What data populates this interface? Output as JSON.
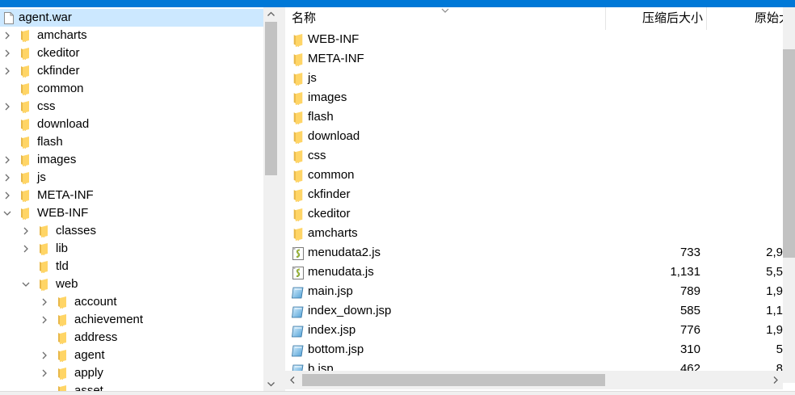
{
  "tree": {
    "items": [
      {
        "label": "agent.war",
        "icon": "archive-file-icon",
        "name": "tree-item-agent-war"
      },
      {
        "label": "amcharts",
        "icon": "folder-icon",
        "name": "tree-item-amcharts"
      },
      {
        "label": "ckeditor",
        "icon": "folder-icon",
        "name": "tree-item-ckeditor"
      },
      {
        "label": "ckfinder",
        "icon": "folder-icon",
        "name": "tree-item-ckfinder"
      },
      {
        "label": "common",
        "icon": "folder-icon",
        "name": "tree-item-common"
      },
      {
        "label": "css",
        "icon": "folder-icon",
        "name": "tree-item-css"
      },
      {
        "label": "download",
        "icon": "folder-icon",
        "name": "tree-item-download"
      },
      {
        "label": "flash",
        "icon": "folder-icon",
        "name": "tree-item-flash"
      },
      {
        "label": "images",
        "icon": "folder-icon",
        "name": "tree-item-images"
      },
      {
        "label": "js",
        "icon": "folder-icon",
        "name": "tree-item-js"
      },
      {
        "label": "META-INF",
        "icon": "folder-icon",
        "name": "tree-item-meta-inf"
      },
      {
        "label": "WEB-INF",
        "icon": "folder-icon",
        "name": "tree-item-web-inf"
      },
      {
        "label": "classes",
        "icon": "folder-icon",
        "name": "tree-item-classes"
      },
      {
        "label": "lib",
        "icon": "folder-icon",
        "name": "tree-item-lib"
      },
      {
        "label": "tld",
        "icon": "folder-icon",
        "name": "tree-item-tld"
      },
      {
        "label": "web",
        "icon": "folder-icon",
        "name": "tree-item-web"
      },
      {
        "label": "account",
        "icon": "folder-icon",
        "name": "tree-item-account"
      },
      {
        "label": "achievement",
        "icon": "folder-icon",
        "name": "tree-item-achievement"
      },
      {
        "label": "address",
        "icon": "folder-icon",
        "name": "tree-item-address"
      },
      {
        "label": "agent",
        "icon": "folder-icon",
        "name": "tree-item-agent"
      },
      {
        "label": "apply",
        "icon": "folder-icon",
        "name": "tree-item-apply"
      },
      {
        "label": "asset",
        "icon": "folder-icon",
        "name": "tree-item-asset"
      }
    ]
  },
  "list": {
    "columns": {
      "name": "名称",
      "compressed": "压缩后大小",
      "original": "原始大小"
    },
    "rows": [
      {
        "name": "WEB-INF",
        "icon": "folder-icon",
        "compressed": "",
        "original": ""
      },
      {
        "name": "META-INF",
        "icon": "folder-icon",
        "compressed": "",
        "original": ""
      },
      {
        "name": "js",
        "icon": "folder-icon",
        "compressed": "",
        "original": ""
      },
      {
        "name": "images",
        "icon": "folder-icon",
        "compressed": "",
        "original": ""
      },
      {
        "name": "flash",
        "icon": "folder-icon",
        "compressed": "",
        "original": ""
      },
      {
        "name": "download",
        "icon": "folder-icon",
        "compressed": "",
        "original": ""
      },
      {
        "name": "css",
        "icon": "folder-icon",
        "compressed": "",
        "original": ""
      },
      {
        "name": "common",
        "icon": "folder-icon",
        "compressed": "",
        "original": ""
      },
      {
        "name": "ckfinder",
        "icon": "folder-icon",
        "compressed": "",
        "original": ""
      },
      {
        "name": "ckeditor",
        "icon": "folder-icon",
        "compressed": "",
        "original": ""
      },
      {
        "name": "amcharts",
        "icon": "folder-icon",
        "compressed": "",
        "original": ""
      },
      {
        "name": "menudata2.js",
        "icon": "js-file-icon",
        "compressed": "733",
        "original": "2,9"
      },
      {
        "name": "menudata.js",
        "icon": "js-file-icon",
        "compressed": "1,131",
        "original": "5,5"
      },
      {
        "name": "main.jsp",
        "icon": "jsp-file-icon",
        "compressed": "789",
        "original": "1,9"
      },
      {
        "name": "index_down.jsp",
        "icon": "jsp-file-icon",
        "compressed": "585",
        "original": "1,1"
      },
      {
        "name": "index.jsp",
        "icon": "jsp-file-icon",
        "compressed": "776",
        "original": "1,9"
      },
      {
        "name": "bottom.jsp",
        "icon": "jsp-file-icon",
        "compressed": "310",
        "original": "5"
      },
      {
        "name": "b.jsp",
        "icon": "jsp-file-icon",
        "compressed": "462",
        "original": "8"
      }
    ]
  },
  "colors": {
    "titlebar": "#0078d7",
    "selection": "#cce8ff",
    "folder": "#ffd566",
    "folder_dark": "#e8b84a",
    "scrollbar_track": "#f0f0f0",
    "scrollbar_thumb": "#c2c2c2"
  }
}
